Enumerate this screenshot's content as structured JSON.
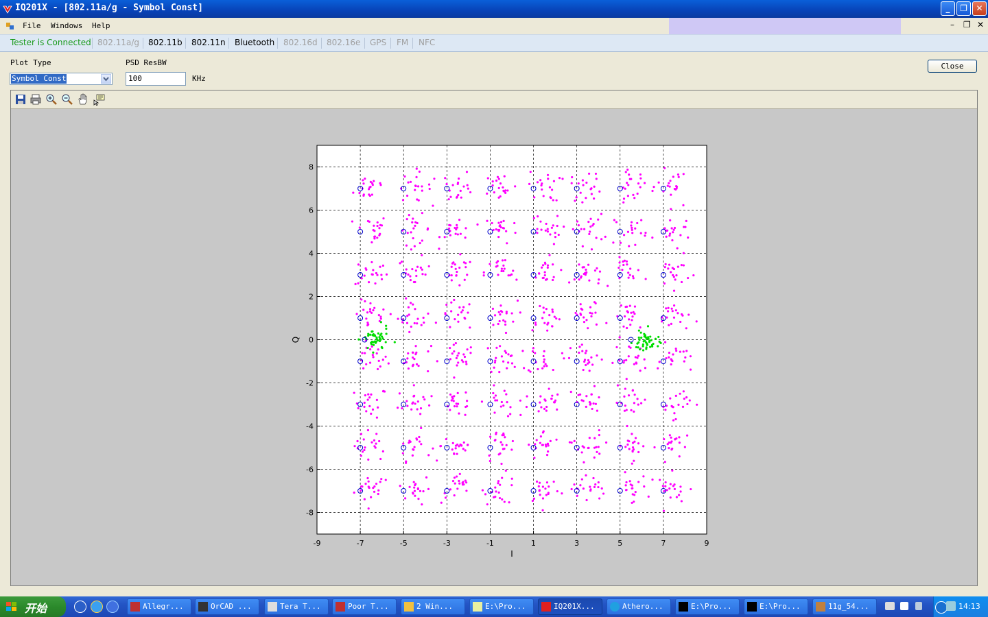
{
  "window": {
    "title": "IQ201X - [802.11a/g - Symbol Const]"
  },
  "menu": {
    "items": [
      "File",
      "Windows",
      "Help"
    ]
  },
  "status_text": "Tester is Connected",
  "tabs": [
    {
      "label": "802.11a/g",
      "enabled": false
    },
    {
      "label": "802.11b",
      "enabled": true
    },
    {
      "label": "802.11n",
      "enabled": true
    },
    {
      "label": "Bluetooth",
      "enabled": true
    },
    {
      "label": "802.16d",
      "enabled": false
    },
    {
      "label": "802.16e",
      "enabled": false
    },
    {
      "label": "GPS",
      "enabled": false
    },
    {
      "label": "FM",
      "enabled": false
    },
    {
      "label": "NFC",
      "enabled": false
    }
  ],
  "controls": {
    "plot_type_label": "Plot Type",
    "plot_type_value": "Symbol Const",
    "psd_label": "PSD ResBW",
    "psd_value": "100",
    "psd_unit": "KHz",
    "close_label": "Close"
  },
  "toolbar": {
    "icons": [
      "save-icon",
      "print-icon",
      "zoom-in-icon",
      "zoom-out-icon",
      "pan-hand-icon",
      "data-cursor-icon"
    ]
  },
  "chart_data": {
    "type": "scatter",
    "title": "",
    "xlabel": "I",
    "ylabel": "Q",
    "xlim": [
      -9,
      9
    ],
    "ylim": [
      -9,
      9
    ],
    "xticks": [
      -9,
      -7,
      -5,
      -3,
      -1,
      1,
      3,
      5,
      7,
      9
    ],
    "yticks": [
      -8,
      -6,
      -4,
      -2,
      0,
      2,
      4,
      6,
      8
    ],
    "grid": true,
    "ideal_points": {
      "i_levels": [
        -7,
        -5,
        -3,
        -1,
        1,
        3,
        5,
        7
      ],
      "q_levels": [
        -7,
        -5,
        -3,
        -1,
        1,
        3,
        5,
        7
      ],
      "pilot_points": [
        [
          -6.8,
          0
        ],
        [
          5.5,
          0
        ]
      ],
      "marker": "circle",
      "color": "#0000cc"
    },
    "series": [
      {
        "values_desc": "64-QAM data symbols clustered around each ideal point (spread ~0.5)",
        "color": "#ff00ff"
      },
      {
        "values_desc": "pilot symbols clustered near (-6.3, 0) and (6.2, -0.1)",
        "color": "#00dd00"
      }
    ],
    "data_cluster_centers_I": [
      -7,
      -5,
      -3,
      -1,
      1,
      3,
      5,
      7
    ],
    "data_cluster_centers_Q": [
      -7,
      -5,
      -3,
      -1,
      1,
      3,
      5,
      7
    ],
    "pilot_cluster_centers": [
      [
        -6.3,
        0
      ],
      [
        6.2,
        -0.1
      ]
    ]
  },
  "taskbar": {
    "start_label": "开始",
    "tasks": [
      "Allegr...",
      "OrCAD ...",
      "Tera T...",
      "Poor T...",
      "2 Win...",
      "E:\\Pro...",
      "IQ201X...",
      "Athero...",
      "E:\\Pro...",
      "E:\\Pro...",
      "11g_54..."
    ],
    "clock": "14:13"
  }
}
